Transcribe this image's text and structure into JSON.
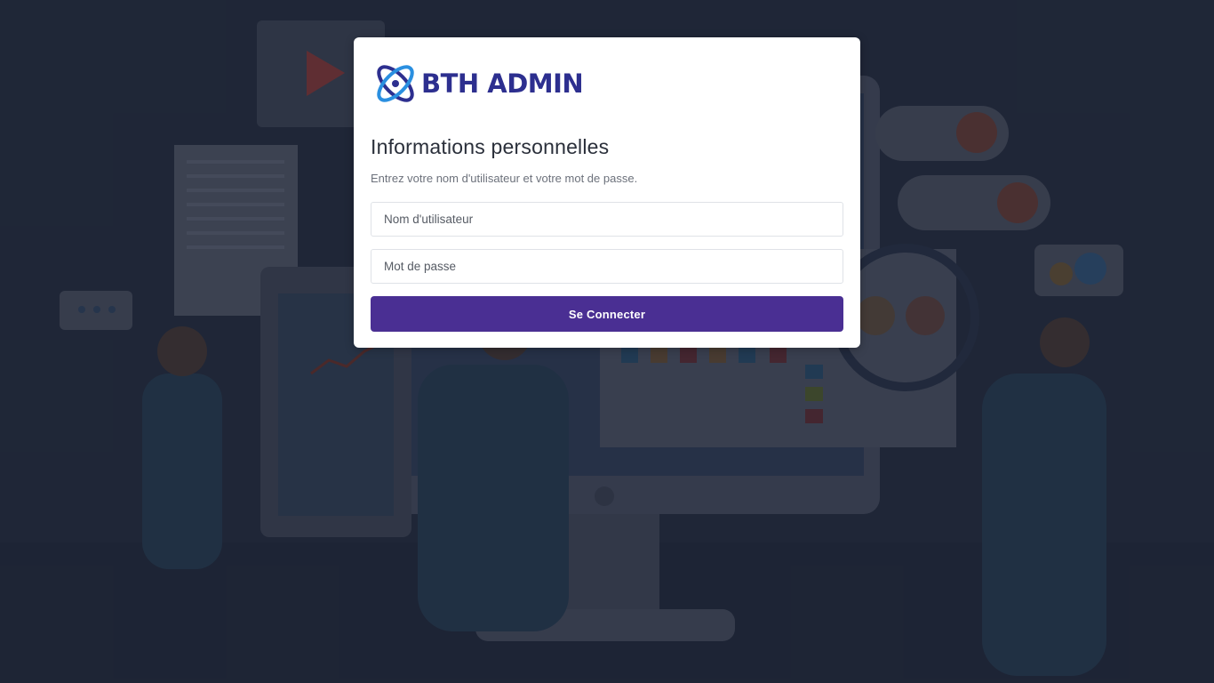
{
  "brand": {
    "name": "BTH ADMIN",
    "color": "#2d2f8f",
    "icon": "orbit-logo-icon"
  },
  "login": {
    "title": "Informations personnelles",
    "subtitle": "Entrez votre nom d'utilisateur et votre mot de passe.",
    "username": {
      "placeholder": "Nom d'utilisateur",
      "value": ""
    },
    "password": {
      "placeholder": "Mot de passe",
      "value": ""
    },
    "submit_label": "Se Connecter",
    "accent": "#4a2f93"
  },
  "background": {
    "theme": "office-analytics-illustration",
    "tint": "#1d2333"
  }
}
